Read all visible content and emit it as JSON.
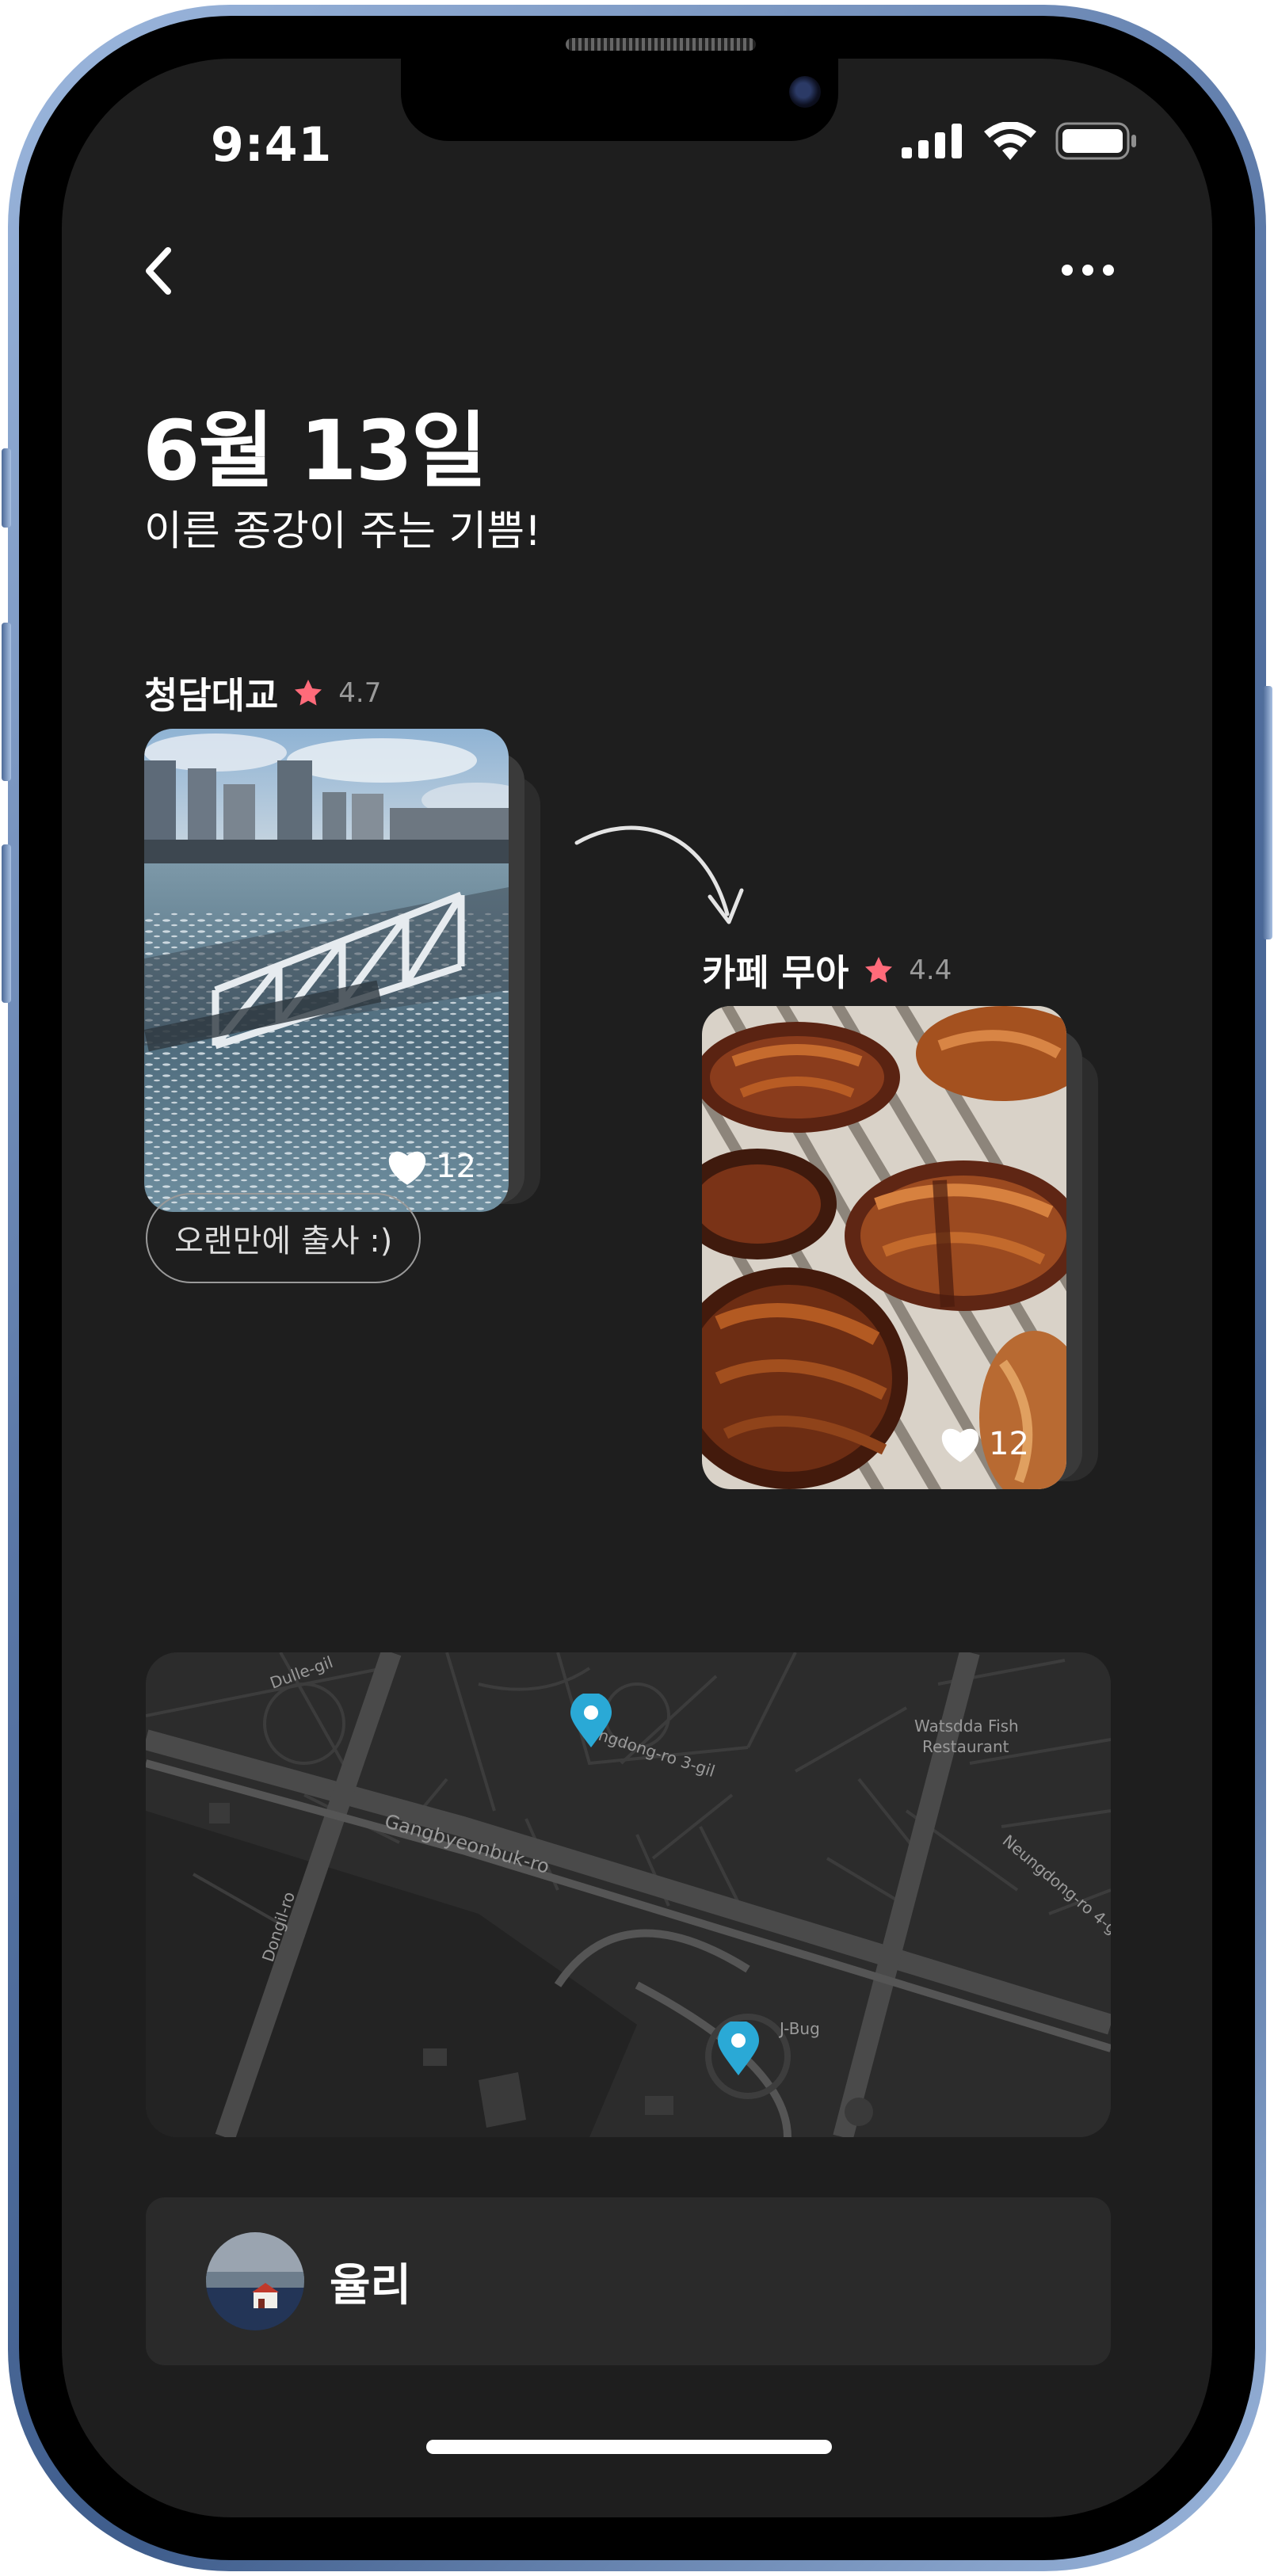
{
  "status_bar": {
    "time": "9:41"
  },
  "header": {
    "back_icon": "chevron-left-icon",
    "more_icon": "more-horizontal-icon"
  },
  "post": {
    "title": "6월 13일",
    "subtitle": "이른 종강이 주는 기쁨!"
  },
  "places": [
    {
      "name": "청담대교",
      "rating": "4.7",
      "likes": "12",
      "memo": "오랜만에 출사 :)"
    },
    {
      "name": "카페 무아",
      "rating": "4.4",
      "likes": "12"
    }
  ],
  "map": {
    "labels": {
      "dulle": "Dulle-gil",
      "ttukseom": "ngdong-ro 3-gil",
      "gangbyeon": "Gangbyeonbuk-ro",
      "dongil": "Dongil-ro",
      "watsdda_1": "Watsdda Fish",
      "watsdda_2": "Restaurant",
      "neungdong": "Neungdong-ro 4-g",
      "jbug": "J-Bug"
    }
  },
  "author": {
    "name": "율리"
  },
  "colors": {
    "background": "#1e1e1e",
    "card": "#2a2a2a",
    "star": "#ff6b7a",
    "pin": "#2aa9d6"
  }
}
